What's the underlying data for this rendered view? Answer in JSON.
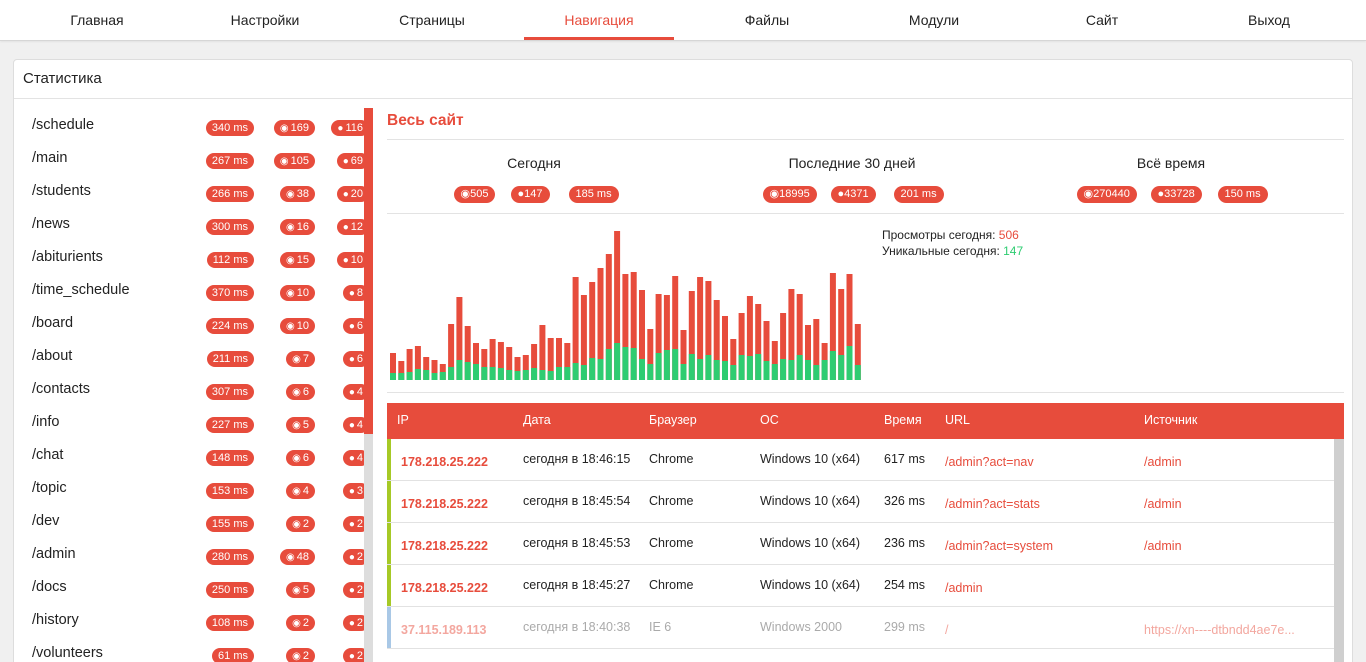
{
  "nav": [
    "Главная",
    "Настройки",
    "Страницы",
    "Навигация",
    "Файлы",
    "Модули",
    "Сайт",
    "Выход"
  ],
  "panel_title": "Статистика",
  "pages": [
    {
      "name": "/schedule",
      "ms": "340 ms",
      "views": "169",
      "users": "116"
    },
    {
      "name": "/main",
      "ms": "267 ms",
      "views": "105",
      "users": "69"
    },
    {
      "name": "/students",
      "ms": "266 ms",
      "views": "38",
      "users": "20"
    },
    {
      "name": "/news",
      "ms": "300 ms",
      "views": "16",
      "users": "12"
    },
    {
      "name": "/abiturients",
      "ms": "112 ms",
      "views": "15",
      "users": "10"
    },
    {
      "name": "/time_schedule",
      "ms": "370 ms",
      "views": "10",
      "users": "8"
    },
    {
      "name": "/board",
      "ms": "224 ms",
      "views": "10",
      "users": "6"
    },
    {
      "name": "/about",
      "ms": "211 ms",
      "views": "7",
      "users": "6"
    },
    {
      "name": "/contacts",
      "ms": "307 ms",
      "views": "6",
      "users": "4"
    },
    {
      "name": "/info",
      "ms": "227 ms",
      "views": "5",
      "users": "4"
    },
    {
      "name": "/chat",
      "ms": "148 ms",
      "views": "6",
      "users": "4"
    },
    {
      "name": "/topic",
      "ms": "153 ms",
      "views": "4",
      "users": "3"
    },
    {
      "name": "/dev",
      "ms": "155 ms",
      "views": "2",
      "users": "2"
    },
    {
      "name": "/admin",
      "ms": "280 ms",
      "views": "48",
      "users": "2"
    },
    {
      "name": "/docs",
      "ms": "250 ms",
      "views": "5",
      "users": "2"
    },
    {
      "name": "/history",
      "ms": "108 ms",
      "views": "2",
      "users": "2"
    },
    {
      "name": "/volunteers",
      "ms": "61 ms",
      "views": "2",
      "users": "2"
    }
  ],
  "site_title": "Весь сайт",
  "periods": [
    {
      "label": "Сегодня",
      "views": "505",
      "users": "147",
      "ms": "185 ms"
    },
    {
      "label": "Последние 30 дней",
      "views": "18995",
      "users": "4371",
      "ms": "201 ms"
    },
    {
      "label": "Всё время",
      "views": "270440",
      "users": "33728",
      "ms": "150 ms"
    }
  ],
  "legend": {
    "views_label": "Просмотры сегодня:",
    "views_value": "506",
    "unique_label": "Уникальные сегодня:",
    "unique_value": "147"
  },
  "chart_data": {
    "type": "bar",
    "series": [
      {
        "name": "Просмотры сегодня",
        "color": "#e74c3c",
        "values": [
          27,
          19,
          31,
          34,
          23,
          20,
          16,
          56,
          83,
          54,
          37,
          31,
          41,
          38,
          33,
          23,
          25,
          36,
          55,
          42,
          42,
          37,
          103,
          85,
          98,
          112,
          126,
          149,
          106,
          108,
          90,
          51,
          86,
          85,
          104,
          50,
          89,
          103,
          99,
          80,
          64,
          41,
          67,
          84,
          76,
          59,
          39,
          67,
          91,
          86,
          55,
          61,
          37,
          107,
          91,
          106,
          56
        ]
      },
      {
        "name": "Уникальные сегодня",
        "color": "#2ecc71",
        "values": [
          7,
          7,
          8,
          11,
          10,
          7,
          8,
          13,
          20,
          18,
          16,
          13,
          13,
          12,
          10,
          9,
          10,
          12,
          10,
          9,
          13,
          13,
          17,
          15,
          22,
          21,
          31,
          37,
          33,
          32,
          21,
          16,
          27,
          30,
          31,
          16,
          26,
          21,
          25,
          20,
          19,
          15,
          25,
          24,
          26,
          19,
          16,
          21,
          20,
          25,
          20,
          15,
          20,
          29,
          25,
          34,
          15
        ]
      }
    ]
  },
  "table": {
    "headers": [
      "IP",
      "Дата",
      "Браузер",
      "ОС",
      "Время",
      "URL",
      "Источник"
    ],
    "rows": [
      {
        "ip": "178.218.25.222",
        "date": "сегодня в 18:46:15",
        "browser": "Chrome",
        "os": "Windows 10 (x64)",
        "time": "617 ms",
        "url": "/admin?act=nav",
        "src": "/admin",
        "stripe": "#a6c926",
        "faded": false
      },
      {
        "ip": "178.218.25.222",
        "date": "сегодня в 18:45:54",
        "browser": "Chrome",
        "os": "Windows 10 (x64)",
        "time": "326 ms",
        "url": "/admin?act=stats",
        "src": "/admin",
        "stripe": "#a6c926",
        "faded": false
      },
      {
        "ip": "178.218.25.222",
        "date": "сегодня в 18:45:53",
        "browser": "Chrome",
        "os": "Windows 10 (x64)",
        "time": "236 ms",
        "url": "/admin?act=system",
        "src": "/admin",
        "stripe": "#a6c926",
        "faded": false
      },
      {
        "ip": "178.218.25.222",
        "date": "сегодня в 18:45:27",
        "browser": "Chrome",
        "os": "Windows 10 (x64)",
        "time": "254 ms",
        "url": "/admin",
        "src": "",
        "stripe": "#a6c926",
        "faded": false
      },
      {
        "ip": "37.115.189.113",
        "date": "сегодня в 18:40:38",
        "browser": "IE 6",
        "os": "Windows 2000",
        "time": "299 ms",
        "url": "/",
        "src": "https://xn----dtbndd4ae7e...",
        "stripe": "#a9c8e6",
        "faded": true
      }
    ]
  }
}
